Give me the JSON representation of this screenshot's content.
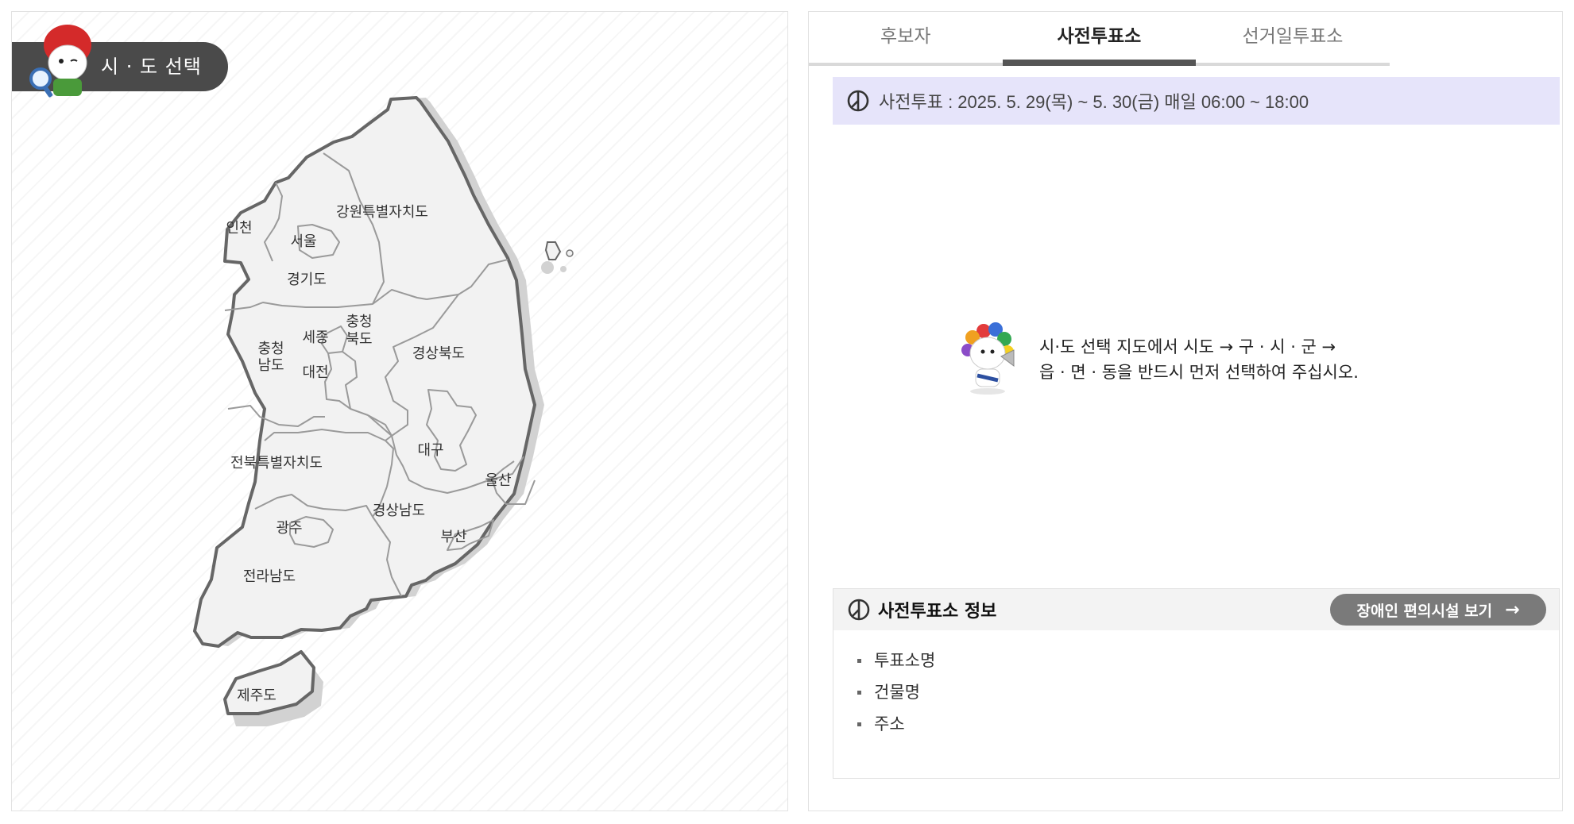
{
  "map_panel": {
    "badge_label": "시 · 도 선택",
    "regions": {
      "incheon": "인천",
      "seoul": "서울",
      "gyeonggi": "경기도",
      "gangwon": "강원특별자치도",
      "chungnam": "충청\n남도",
      "chungnam_l1": "충청",
      "chungnam_l2": "남도",
      "sejong": "세종",
      "chungbuk_l1": "충청",
      "chungbuk_l2": "북도",
      "daejeon": "대전",
      "gyeongbuk": "경상북도",
      "daegu": "대구",
      "jeonbuk": "전북특별자치도",
      "ulsan": "울산",
      "gyeongnam": "경상남도",
      "busan": "부산",
      "gwangju": "광주",
      "jeonnam": "전라남도",
      "jeju": "제주도"
    }
  },
  "tabs": [
    {
      "label": "후보자",
      "active": false
    },
    {
      "label": "사전투표소",
      "active": true
    },
    {
      "label": "선거일투표소",
      "active": false
    }
  ],
  "period": {
    "text": "사전투표 : 2025. 5. 29(목) ~ 5. 30(금) 매일 06:00 ~ 18:00",
    "icon": "ballot-mark-icon"
  },
  "guide": {
    "line1": "시·도 선택 지도에서 시도 → 구 · 시 · 군 →",
    "line2": "읍 · 면 · 동을 반드시 먼저 선택하여 주십시오."
  },
  "booth_info": {
    "title": "사전투표소 정보",
    "facility_button": "장애인 편의시설 보기",
    "fields": [
      "투표소명",
      "건물명",
      "주소"
    ]
  },
  "colors": {
    "badge_bg": "#4a4a4a",
    "period_bg": "#e6e4fa",
    "button_bg": "#7a7a7a",
    "region_fill": "#f2f2f2",
    "region_border": "#666666"
  }
}
